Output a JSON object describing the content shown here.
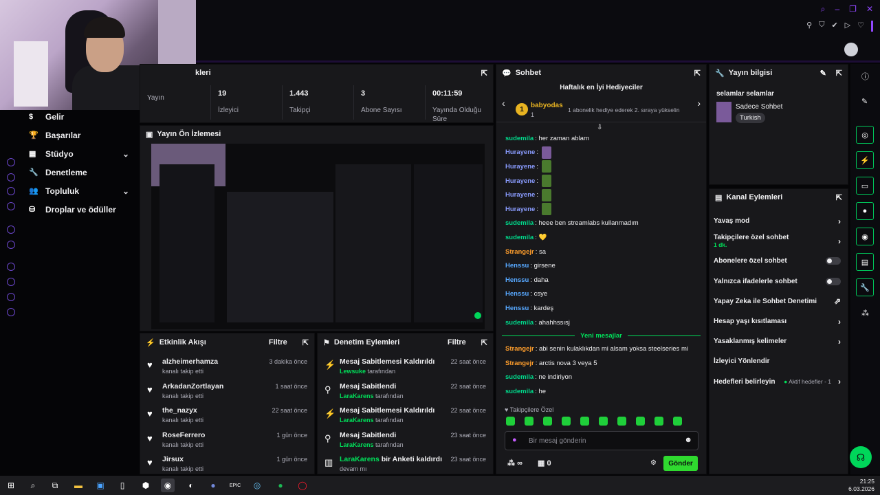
{
  "colors": {
    "accent": "#9147ff",
    "green": "#00e05a",
    "panel": "#18181b"
  },
  "sidenav": {
    "items": [
      {
        "label": "Gelir",
        "icon": "money-icon"
      },
      {
        "label": "Başarılar",
        "icon": "trophy-icon"
      },
      {
        "label": "Stüdyo",
        "icon": "studio-icon",
        "chevron": true
      },
      {
        "label": "Denetleme",
        "icon": "wrench-icon"
      },
      {
        "label": "Topluluk",
        "icon": "community-icon",
        "chevron": true
      },
      {
        "label": "Droplar ve ödüller",
        "icon": "gift-icon"
      }
    ]
  },
  "stats": {
    "title": "Oturum Bilgileri",
    "title_visible": "kleri",
    "items": [
      {
        "value": "",
        "label": "Yayın"
      },
      {
        "value": "19",
        "label": "İzleyici"
      },
      {
        "value": "1.443",
        "label": "Takipçi"
      },
      {
        "value": "3",
        "label": "Abone Sayısı"
      },
      {
        "value": "00:11:59",
        "label": "Yayında Olduğu Süre"
      }
    ]
  },
  "preview": {
    "title": "Yayın Ön İzlemesi"
  },
  "activity": {
    "title": "Etkinlik Akışı",
    "filter": "Filtre",
    "items": [
      {
        "name": "alzheimerhamza",
        "sub": "kanalı takip etti",
        "time": "3 dakika önce"
      },
      {
        "name": "ArkadanZortlayan",
        "sub": "kanalı takip etti",
        "time": "1 saat önce"
      },
      {
        "name": "the_nazyx",
        "sub": "kanalı takip etti",
        "time": "22 saat önce"
      },
      {
        "name": "RoseFerrero",
        "sub": "kanalı takip etti",
        "time": "1 gün önce"
      },
      {
        "name": "Jirsux",
        "sub": "kanalı takip etti",
        "time": "1 gün önce"
      }
    ]
  },
  "moderation": {
    "title": "Denetim Eylemleri",
    "filter": "Filtre",
    "items": [
      {
        "name": "Mesaj Sabitlemesi Kaldırıldı",
        "by": "Lewsuke",
        "suffix": "tarafından",
        "time": "22 saat önce",
        "icon": "unpin-icon"
      },
      {
        "name": "Mesaj Sabitlendi",
        "by": "LaraKarens",
        "suffix": "tarafından",
        "time": "22 saat önce",
        "icon": "pin-icon"
      },
      {
        "name": "Mesaj Sabitlemesi Kaldırıldı",
        "by": "LaraKarens",
        "suffix": "tarafından",
        "time": "22 saat önce",
        "icon": "unpin-icon"
      },
      {
        "name": "Mesaj Sabitlendi",
        "by": "LaraKarens",
        "suffix": "tarafından",
        "time": "23 saat önce",
        "icon": "pin-icon"
      },
      {
        "name_user": "LaraKarens",
        "name_rest": " bir Anketi kaldırdı",
        "sub": "devam mı",
        "time": "23 saat önce",
        "icon": "poll-icon"
      }
    ]
  },
  "chat": {
    "title": "Sohbet",
    "gifters_title": "Haftalık en İyi Hediyeciler",
    "gifter": {
      "rank": "1",
      "name": "babyodas",
      "count": "1",
      "note": "1 abonelik hediye ederek 2. sıraya yükselin"
    },
    "messages": [
      {
        "user": "sudemila",
        "color": "g",
        "text": "her zaman ablam"
      },
      {
        "user": "Hurayene",
        "color": "p",
        "text": "",
        "emote": "pur"
      },
      {
        "user": "Hurayene",
        "color": "p",
        "text": "",
        "emote": "grn"
      },
      {
        "user": "Hurayene",
        "color": "p",
        "text": "",
        "emote": "grn"
      },
      {
        "user": "Hurayene",
        "color": "p",
        "text": "",
        "emote": "grn"
      },
      {
        "user": "Hurayene",
        "color": "p",
        "text": "",
        "emote": "grn"
      },
      {
        "user": "sudemila",
        "color": "g",
        "text": "heee ben streamlabs kullanmadım"
      },
      {
        "user": "sudemila",
        "color": "g",
        "text": "",
        "emote": "heart"
      },
      {
        "user": "Strangejr",
        "color": "o",
        "text": "sa"
      },
      {
        "user": "Henssu",
        "color": "b",
        "text": "girsene"
      },
      {
        "user": "Henssu",
        "color": "b",
        "text": "daha"
      },
      {
        "user": "Henssu",
        "color": "b",
        "text": "csye"
      },
      {
        "user": "Henssu",
        "color": "b",
        "text": "kardeş"
      },
      {
        "user": "sudemila",
        "color": "g",
        "text": "ahahhssısj"
      }
    ],
    "new_label": "Yeni mesajlar",
    "new_messages": [
      {
        "user": "Strangejr",
        "color": "o",
        "text": "abi senin kulaklıkdan mi alsam yoksa steelseries mi"
      },
      {
        "user": "Strangejr",
        "color": "o",
        "text": "arctis nova 3 veya 5"
      },
      {
        "user": "sudemila",
        "color": "g",
        "text": "ne indiriyon"
      },
      {
        "user": "sudemila",
        "color": "g",
        "text": "he"
      }
    ],
    "followers_only": "Takipçilere Özel",
    "placeholder": "Bir mesaj gönderin",
    "points": "∞",
    "drops": "0",
    "send": "Gönder"
  },
  "stream_info": {
    "title": "Yayın bilgisi",
    "stream_title": "selamlar selamlar",
    "category": "Sadece Sohbet",
    "tag": "Turkish"
  },
  "channel": {
    "title": "Kanal Eylemleri",
    "items": [
      {
        "label": "Yavaş mod",
        "kind": "arrow"
      },
      {
        "label": "Takipçilere özel sohbet",
        "sub": "1 dk.",
        "kind": "arrow"
      },
      {
        "label": "Abonelere özel sohbet",
        "kind": "toggle"
      },
      {
        "label": "Yalnızca ifadelerle sohbet",
        "kind": "toggle"
      },
      {
        "label": "Yapay Zeka ile Sohbet Denetimi",
        "kind": "ext"
      },
      {
        "label": "Hesap yaşı kısıtlaması",
        "kind": "arrow"
      },
      {
        "label": "Yasaklanmış kelimeler",
        "kind": "arrow"
      },
      {
        "label": "İzleyici Yönlendir",
        "kind": "none"
      },
      {
        "label": "Hedefleri belirleyin",
        "kind": "arrow",
        "extra": "Aktif hedefler - 1"
      }
    ]
  },
  "taskbar": {
    "time": "21:25",
    "date": "6.03.2026"
  }
}
